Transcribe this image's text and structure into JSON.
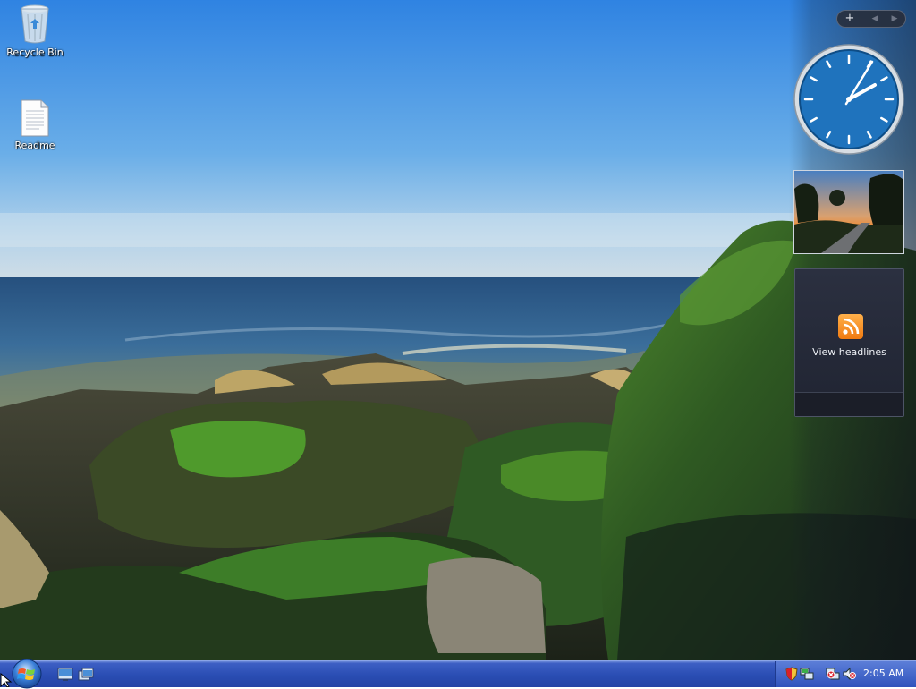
{
  "desktop": {
    "icons": [
      {
        "label": "Recycle Bin"
      },
      {
        "label": "Readme"
      }
    ]
  },
  "sidebar": {
    "controls": {
      "add": "+",
      "prev": "◀",
      "next": "▶"
    },
    "feed": {
      "label": "View headlines"
    }
  },
  "taskbar": {
    "clock": "2:05 AM"
  },
  "colors": {
    "taskbar": "#2a4db3",
    "sky_top": "#3a8ae0",
    "sea": "#2a5a8a",
    "moss": "#3f8a2a",
    "feed_orange": "#f08a20"
  }
}
